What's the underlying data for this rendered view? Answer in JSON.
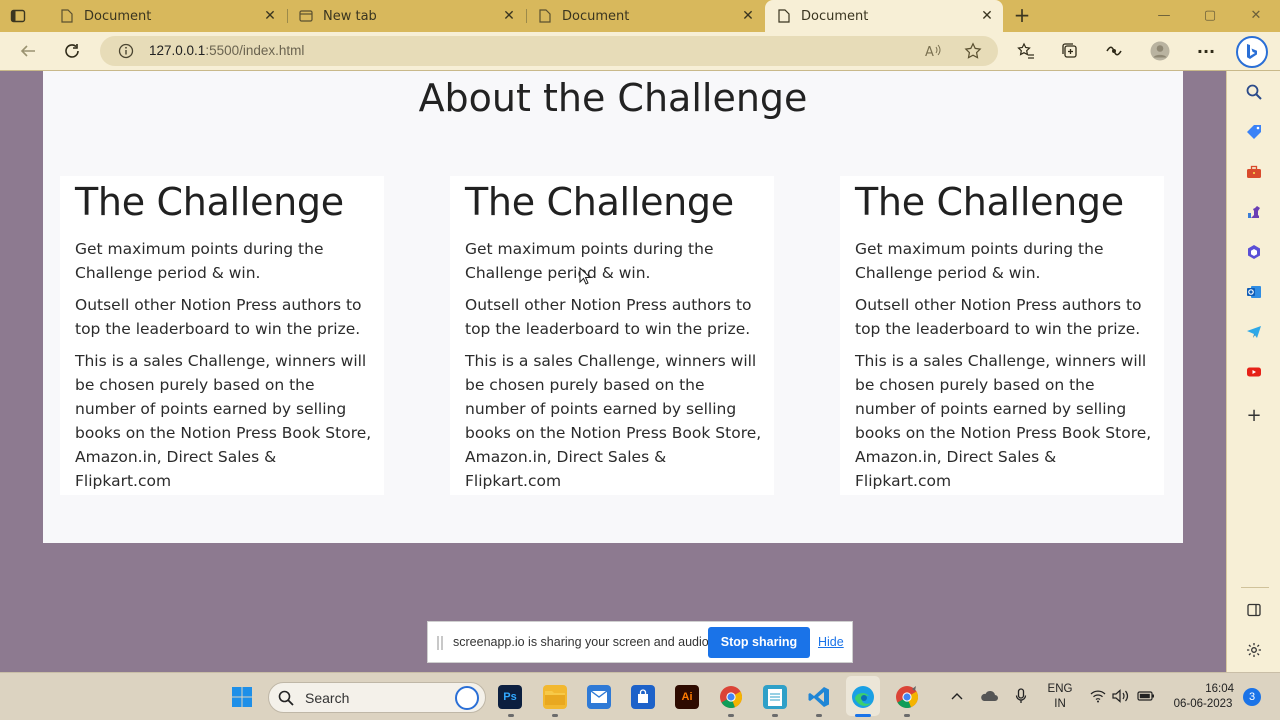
{
  "browser": {
    "tabs": [
      {
        "label": "Document",
        "active": false
      },
      {
        "label": "New tab",
        "active": false
      },
      {
        "label": "Document",
        "active": false
      },
      {
        "label": "Document",
        "active": true
      }
    ],
    "url_host": "127.0.0.1",
    "url_rest": ":5500/index.html"
  },
  "page": {
    "section_title": "About the Challenge",
    "cards": [
      {
        "heading": "The Challenge",
        "paragraphs": [
          "Get maximum points during the Challenge period & win.",
          "Outsell other Notion Press authors to top the leaderboard to win the prize.",
          "This is a sales Challenge, winners will be chosen purely based on the number of points earned by selling books on the Notion Press Book Store, Amazon.in, Direct Sales & Flipkart.com"
        ]
      },
      {
        "heading": "The Challenge",
        "paragraphs": [
          "Get maximum points during the Challenge period & win.",
          "Outsell other Notion Press authors to top the leaderboard to win the prize.",
          "This is a sales Challenge, winners will be chosen purely based on the number of points earned by selling books on the Notion Press Book Store, Amazon.in, Direct Sales & Flipkart.com"
        ]
      },
      {
        "heading": "The Challenge",
        "paragraphs": [
          "Get maximum points during the Challenge period & win.",
          "Outsell other Notion Press authors to top the leaderboard to win the prize.",
          "This is a sales Challenge, winners will be chosen purely based on the number of points earned by selling books on the Notion Press Book Store, Amazon.in, Direct Sales & Flipkart.com"
        ]
      }
    ]
  },
  "sharebar": {
    "message": "screenapp.io is sharing your screen and audio.",
    "stop_label": "Stop sharing",
    "hide_label": "Hide"
  },
  "taskbar": {
    "search_placeholder": "Search",
    "apps": [
      "windows-start",
      "photoshop",
      "file-explorer",
      "mail",
      "store",
      "illustrator",
      "chrome",
      "notepad",
      "vscode",
      "edge",
      "chrome-canary"
    ],
    "lang_line1": "ENG",
    "lang_line2": "IN",
    "time": "16:04",
    "date": "06-06-2023",
    "notification_count": "3"
  },
  "colors": {
    "tab_strip": "#d8b85c",
    "toolbar": "#f7efd6",
    "page_background": "#8d7a90",
    "container": "#f8f8fa",
    "accent": "#1a73e8"
  }
}
